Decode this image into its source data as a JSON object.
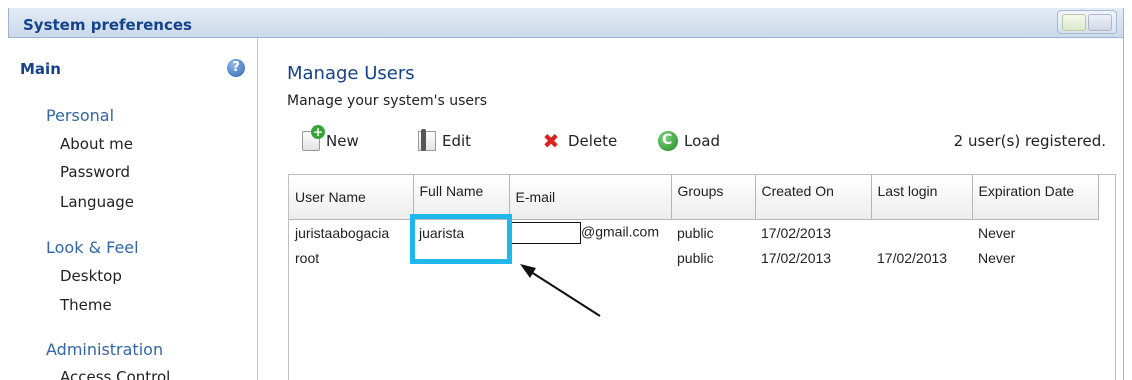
{
  "window": {
    "title": "System preferences"
  },
  "sidebar": {
    "main_label": "Main",
    "sections": [
      {
        "title": "Personal",
        "items": [
          "About me",
          "Password",
          "Language"
        ]
      },
      {
        "title": "Look & Feel",
        "items": [
          "Desktop",
          "Theme"
        ]
      },
      {
        "title": "Administration",
        "items": [
          "Access Control"
        ]
      }
    ]
  },
  "main": {
    "title": "Manage Users",
    "subtitle": "Manage your system's users",
    "toolbar": {
      "new_label": "New",
      "edit_label": "Edit",
      "delete_label": "Delete",
      "load_label": "Load"
    },
    "users_count": "2 user(s) registered.",
    "table": {
      "headers": [
        "User Name",
        "Full Name",
        "E-mail",
        "Groups",
        "Created On",
        "Last login",
        "Expiration Date"
      ],
      "rows": [
        [
          "juristaabogacia",
          "juarista",
          "@gmail.com",
          "public",
          "17/02/2013",
          "",
          "Never"
        ],
        [
          "root",
          "",
          "",
          "public",
          "17/02/2013",
          "17/02/2013",
          "Never"
        ]
      ]
    }
  },
  "colors": {
    "title": "#15428b",
    "section": "#3266a8",
    "highlight": "#20b8ea"
  },
  "icons": {
    "help": "question-circle-icon",
    "new": "new-document-icon",
    "edit": "edit-icon",
    "delete": "red-x-icon",
    "load": "reload-icon"
  }
}
